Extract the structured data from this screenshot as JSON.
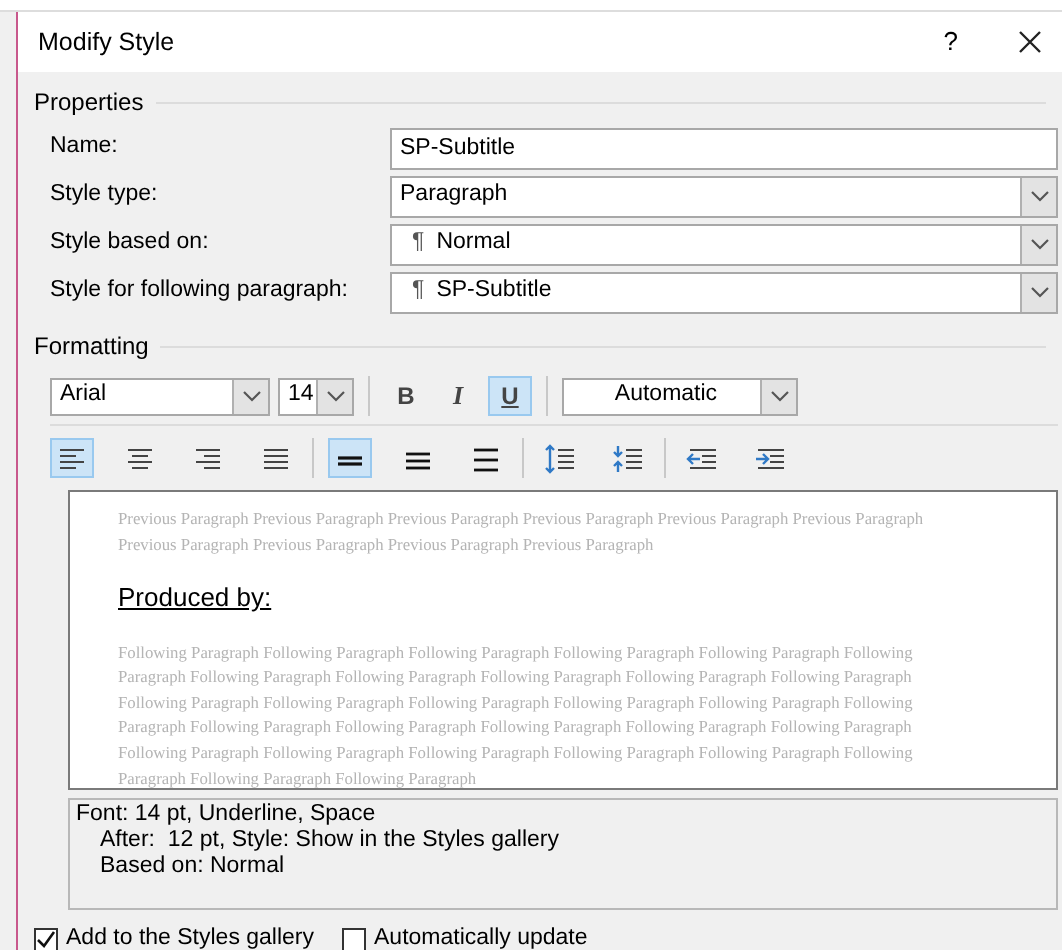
{
  "window": {
    "title": "Modify Style",
    "help": "?"
  },
  "properties": {
    "heading": "Properties",
    "fields": [
      {
        "kind": "text",
        "label": "Name:",
        "value": "SP-Subtitle"
      },
      {
        "kind": "select",
        "label": "Style type:",
        "value": "Paragraph"
      },
      {
        "kind": "select",
        "label": "Style based on:",
        "prefix": "¶",
        "value": "Normal"
      },
      {
        "kind": "select",
        "label": "Style for following paragraph:",
        "prefix": "¶",
        "value": "SP-Subtitle"
      }
    ]
  },
  "formatting": {
    "heading": "Formatting",
    "font": "Arial",
    "size": "14",
    "styles": [
      {
        "kind": "bold",
        "label": "B",
        "selected": false
      },
      {
        "kind": "italic",
        "label": "I",
        "selected": false
      },
      {
        "kind": "underline",
        "label": "U",
        "selected": true
      }
    ],
    "font_color": "Automatic",
    "paragraph_buttons": [
      {
        "kind": "align-left",
        "selected": true
      },
      {
        "kind": "align-center",
        "selected": false
      },
      {
        "kind": "align-right",
        "selected": false
      },
      {
        "kind": "justify",
        "selected": false
      },
      {
        "kind": "single-spacing",
        "selected": true
      },
      {
        "kind": "one-half-spacing",
        "selected": false
      },
      {
        "kind": "double-spacing",
        "selected": false
      },
      {
        "kind": "increase-spacing",
        "selected": false
      },
      {
        "kind": "decrease-spacing",
        "selected": false
      },
      {
        "kind": "decrease-indent",
        "selected": false
      },
      {
        "kind": "increase-indent",
        "selected": false
      }
    ]
  },
  "preview": {
    "previous": "Previous Paragraph Previous Paragraph Previous Paragraph Previous Paragraph Previous Paragraph Previous Paragraph Previous Paragraph Previous Paragraph Previous Paragraph Previous Paragraph",
    "sample": "Produced by:",
    "following": "Following Paragraph Following Paragraph Following Paragraph Following Paragraph Following Paragraph Following Paragraph Following Paragraph Following Paragraph Following Paragraph Following Paragraph Following Paragraph Following Paragraph Following Paragraph Following Paragraph Following Paragraph Following Paragraph Following Paragraph Following Paragraph Following Paragraph Following Paragraph Following Paragraph Following Paragraph Following Paragraph Following Paragraph Following Paragraph Following Paragraph Following Paragraph Following Paragraph Following Paragraph Following Paragraph"
  },
  "description": [
    "Font: 14 pt, Underline, Space",
    "After:  12 pt, Style: Show in the Styles gallery",
    "Based on: Normal"
  ],
  "options": [
    {
      "label": "Add to the Styles gallery",
      "checked": true
    },
    {
      "label": "Automatically update",
      "checked": false
    }
  ]
}
